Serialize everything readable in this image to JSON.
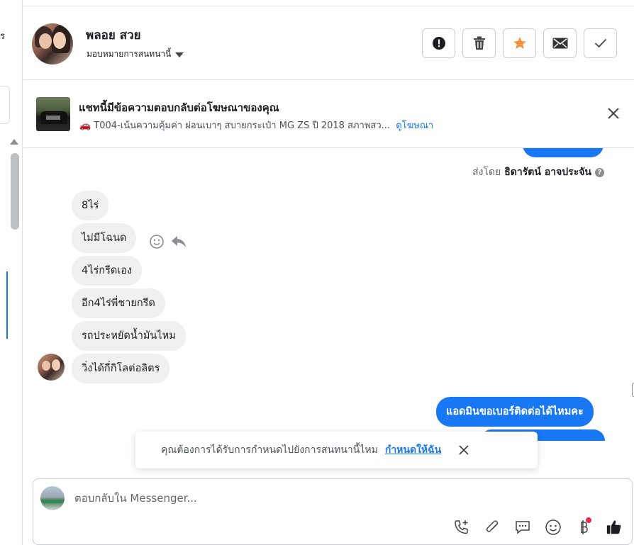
{
  "left_pane": {
    "stub_text": "ร"
  },
  "header": {
    "contact_name": "พลอย สวย",
    "assign_label": "มอบหมายการสนทนานี้",
    "buttons": [
      {
        "name": "spam-button",
        "icon": "exclamation-icon"
      },
      {
        "name": "delete-button",
        "icon": "trash-icon"
      },
      {
        "name": "star-button",
        "icon": "star-icon"
      },
      {
        "name": "mark-unread-button",
        "icon": "envelope-icon"
      },
      {
        "name": "mark-done-button",
        "icon": "checkmark-icon"
      }
    ]
  },
  "ad_banner": {
    "title": "แชทนี้มีข้อความตอบกลับต่อโฆษณาของคุณ",
    "subtitle": "🚗 T004-เน้นความคุ้มค่า ผ่อนเบาๆ สบายกระเป๋า MG ZS ปี 2018 สภาพสว...",
    "link": "ดูโฆษณา"
  },
  "conversation": {
    "sent_by_prefix": "ส่งโดย",
    "sent_by_name": "ธิดารัตน์ อาจประจัน",
    "sent_by_help": "?",
    "incoming": [
      "8ไร่",
      "ไม่มีโฉนด",
      "4ไร่กรีดเอง",
      "อีก4ไร่พี่ชายกรีด",
      "รถประหยัดน้ำมันไหม",
      "วิ่งได้กี่กิโลต่อลิตร"
    ],
    "outgoing": [
      "แอดมินขอเบอร์ติดต่อได้ไหมคะ"
    ]
  },
  "toast": {
    "text": "คุณต้องการได้รับการกำหนดไปยังการสนทนานี้ไหม",
    "link": "กำหนดให้ฉัน"
  },
  "composer": {
    "placeholder": "ตอบกลับใน Messenger..."
  },
  "colors": {
    "accent": "#1877f2",
    "star": "#f7923b",
    "bubble_in": "#f0f0f0",
    "badge_dot": "#f02849"
  }
}
